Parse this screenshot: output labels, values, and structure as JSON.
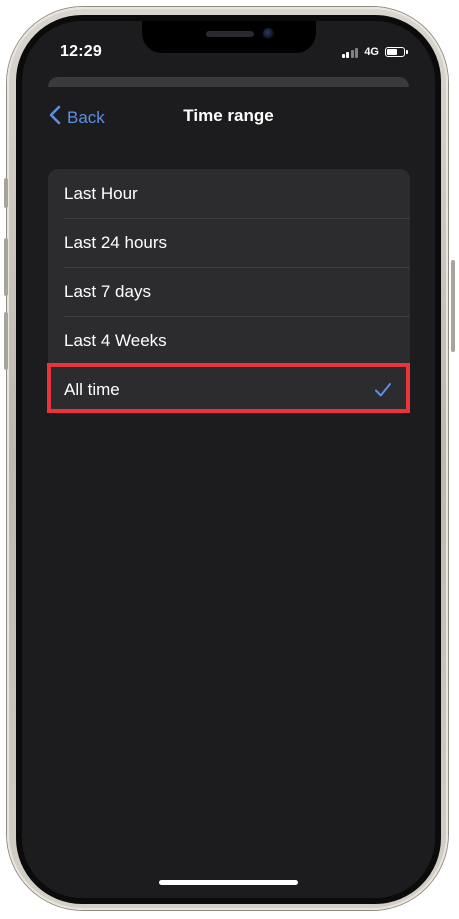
{
  "status_bar": {
    "time": "12:29",
    "network": "4G",
    "battery_level": 0.65
  },
  "nav": {
    "back_label": "Back",
    "title": "Time range"
  },
  "options": [
    {
      "label": "Last Hour",
      "selected": false
    },
    {
      "label": "Last 24 hours",
      "selected": false
    },
    {
      "label": "Last 7 days",
      "selected": false
    },
    {
      "label": "Last 4 Weeks",
      "selected": false
    },
    {
      "label": "All time",
      "selected": true
    }
  ],
  "icons": {
    "back": "chevron-left-icon",
    "selected": "checkmark-icon"
  },
  "colors": {
    "background": "#1c1c1e",
    "row": "#2c2c2e",
    "accent": "#5b8fe3",
    "highlight": "#e8353b"
  }
}
